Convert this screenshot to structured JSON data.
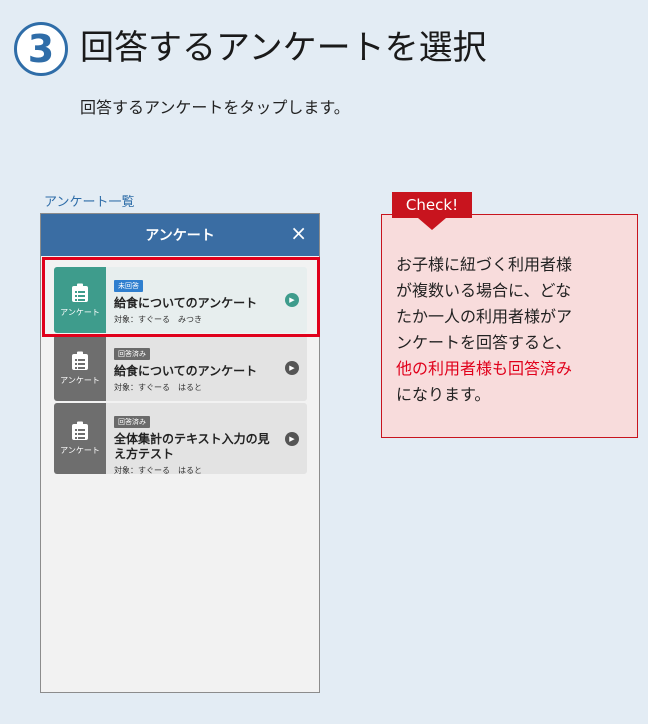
{
  "header": {
    "step_number": "3",
    "title": "回答するアンケートを選択",
    "subtitle": "回答するアンケートをタップします。"
  },
  "list_caption": "アンケート一覧",
  "app": {
    "title": "アンケート",
    "close_icon": "×",
    "cards": [
      {
        "icon": "clipboard-icon",
        "icon_label": "アンケート",
        "tag": "未回答",
        "title": "給食についてのアンケート",
        "target": "対象：すぐーる　みつき"
      },
      {
        "icon": "clipboard-icon",
        "icon_label": "アンケート",
        "tag": "回答済み",
        "title": "給食についてのアンケート",
        "target": "対象：すぐーる　はると"
      },
      {
        "icon": "clipboard-icon",
        "icon_label": "アンケート",
        "tag": "回答済み",
        "title": "全体集計のテキスト入力の見え方テスト",
        "target": "対象：すぐーる　はると"
      }
    ]
  },
  "check": {
    "badge": "Check!",
    "text_before": "お子様に紐づく利用者様\nが複数いる場合に、どな\nたか一人の利用者様がア\nンケートを回答すると、\n",
    "text_red": "他の利用者様も回答済み",
    "text_after": "\nになります。"
  },
  "colors": {
    "accent_blue": "#3a6da3",
    "teal": "#3e9c8c",
    "highlight_red": "#e0001b",
    "check_red": "#c8141e",
    "page_bg": "#e3ecf4"
  }
}
